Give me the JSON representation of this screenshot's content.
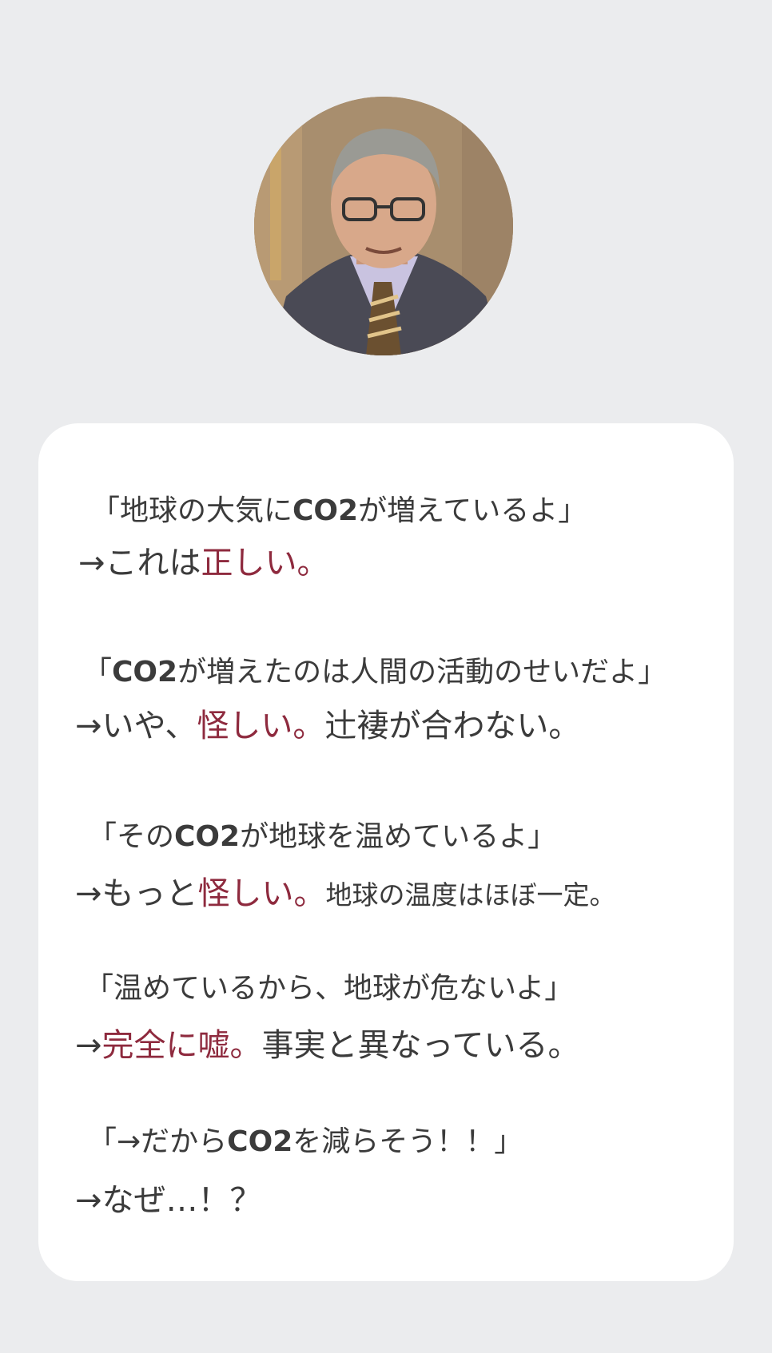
{
  "avatar": {
    "alt": "portrait-photo",
    "colors": {
      "background": "#a88e6e",
      "suit": "#4a4a55",
      "skin": "#d8a88a",
      "hair": "#9a9a94",
      "tie": "#6b5030"
    }
  },
  "colors": {
    "page_background": "#ebecee",
    "card_background": "#ffffff",
    "text": "#3b3b3b",
    "accent": "#8e2a3e"
  },
  "items": [
    {
      "q": {
        "p1": "「地球の大気に",
        "b": "CO2",
        "p2": "が増えているよ」"
      },
      "a": {
        "p1": "→これは",
        "red": "正しい。",
        "p2": ""
      }
    },
    {
      "q": {
        "p1": "「",
        "b": "CO2",
        "p2": "が増えたのは人間の活動のせいだよ」"
      },
      "a": {
        "p1": "→いや、",
        "red": "怪しい。",
        "p2": "辻褄が合わない。"
      }
    },
    {
      "q": {
        "p1": "「その",
        "b": "CO2",
        "p2": "が地球を温めているよ」"
      },
      "a": {
        "p1": "→もっと",
        "red": "怪しい。",
        "p2": "地球の温度はほぼ一定。"
      }
    },
    {
      "q": {
        "p1": "「温めているから、地球が危ないよ」",
        "b": "",
        "p2": ""
      },
      "a": {
        "p1": "→",
        "red": "完全に嘘。",
        "p2": "事実と異なっている。"
      }
    },
    {
      "q": {
        "p1": "「→だから",
        "b": "CO2",
        "p2": "を減らそう！！」"
      },
      "a": {
        "p1": "→なぜ…！？",
        "red": "",
        "p2": ""
      }
    }
  ]
}
